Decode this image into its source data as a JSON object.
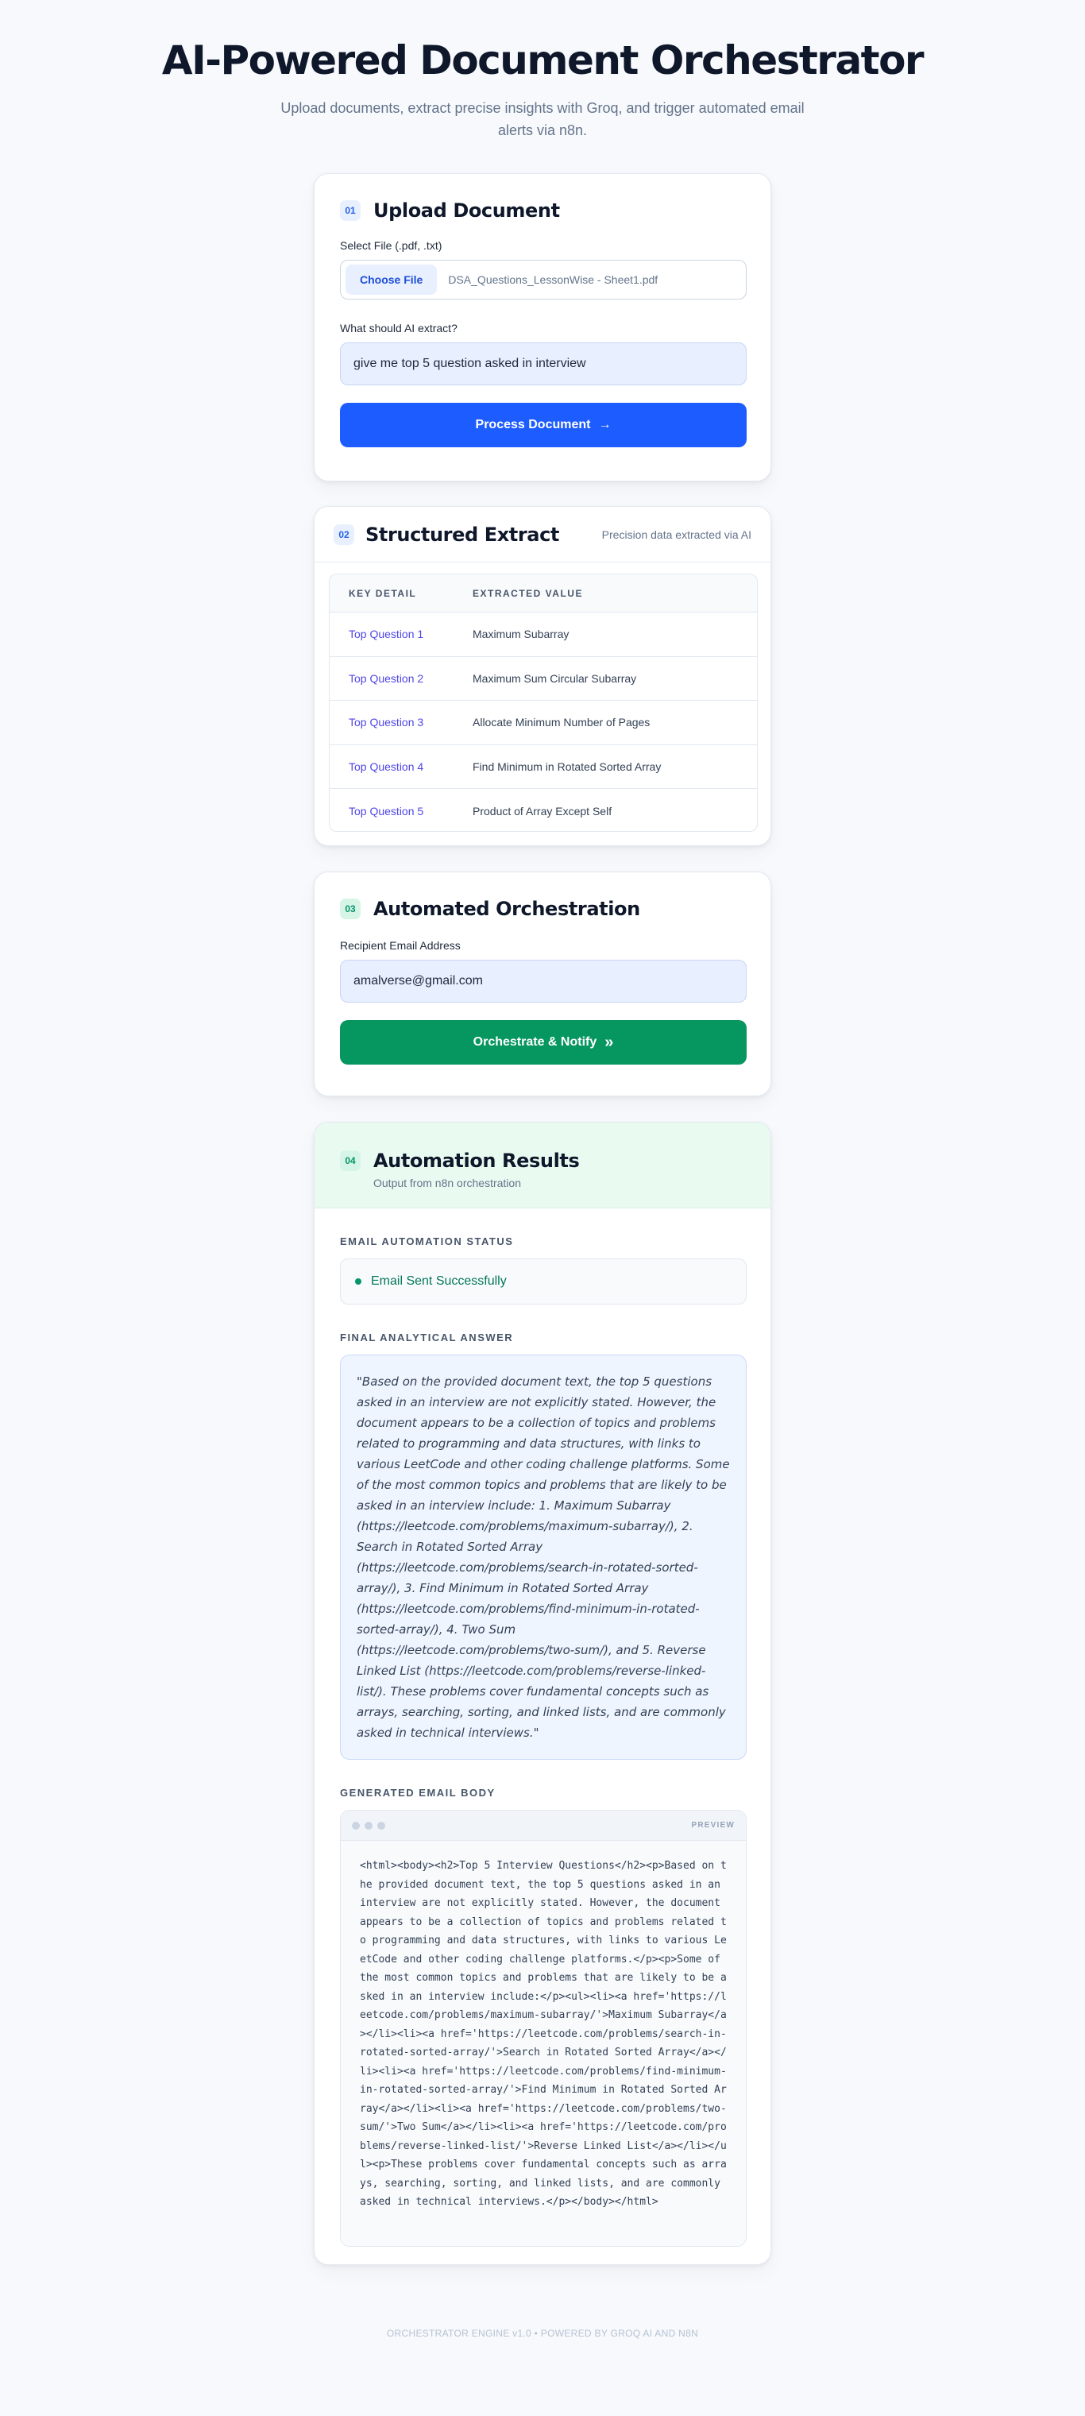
{
  "hero": {
    "title": "AI-Powered Document Orchestrator",
    "subtitle": "Upload documents, extract precise insights with Groq, and trigger automated email alerts via n8n."
  },
  "upload": {
    "step": "01",
    "title": "Upload Document",
    "file_label": "Select File (.pdf, .txt)",
    "choose_file": "Choose File",
    "file_name": "DSA_Questions_LessonWise - Sheet1.pdf",
    "prompt_label": "What should AI extract?",
    "prompt_value": "give me top 5 question asked in interview",
    "process_button": "Process Document",
    "process_icon": "→"
  },
  "extract": {
    "step": "02",
    "title": "Structured Extract",
    "subtitle": "Precision data extracted via AI",
    "col_key": "KEY DETAIL",
    "col_value": "EXTRACTED VALUE",
    "rows": [
      {
        "key": "Top Question 1",
        "value": "Maximum Subarray"
      },
      {
        "key": "Top Question 2",
        "value": "Maximum Sum Circular Subarray"
      },
      {
        "key": "Top Question 3",
        "value": "Allocate Minimum Number of Pages"
      },
      {
        "key": "Top Question 4",
        "value": "Find Minimum in Rotated Sorted Array"
      },
      {
        "key": "Top Question 5",
        "value": "Product of Array Except Self"
      }
    ]
  },
  "orchestration": {
    "step": "03",
    "title": "Automated Orchestration",
    "email_label": "Recipient Email Address",
    "email_value": "amalverse@gmail.com",
    "button": "Orchestrate & Notify",
    "button_icon": "»"
  },
  "results": {
    "step": "04",
    "title": "Automation Results",
    "subtitle": "Output from n8n orchestration",
    "status_label": "EMAIL AUTOMATION STATUS",
    "status_text": "Email Sent Successfully",
    "answer_label": "FINAL ANALYTICAL ANSWER",
    "answer_text": "\"Based on the provided document text, the top 5 questions asked in an interview are not explicitly stated. However, the document appears to be a collection of topics and problems related to programming and data structures, with links to various LeetCode and other coding challenge platforms. Some of the most common topics and problems that are likely to be asked in an interview include: 1. Maximum Subarray (https://leetcode.com/problems/maximum-subarray/), 2. Search in Rotated Sorted Array (https://leetcode.com/problems/search-in-rotated-sorted-array/), 3. Find Minimum in Rotated Sorted Array (https://leetcode.com/problems/find-minimum-in-rotated-sorted-array/), 4. Two Sum (https://leetcode.com/problems/two-sum/), and 5. Reverse Linked List (https://leetcode.com/problems/reverse-linked-list/). These problems cover fundamental concepts such as arrays, searching, sorting, and linked lists, and are commonly asked in technical interviews.\"",
    "email_label": "GENERATED EMAIL BODY",
    "preview_tag": "PREVIEW",
    "email_body": "<html><body><h2>Top 5 Interview Questions</h2><p>Based on the provided document text, the top 5 questions asked in an interview are not explicitly stated. However, the document appears to be a collection of topics and problems related to programming and data structures, with links to various LeetCode and other coding challenge platforms.</p><p>Some of the most common topics and problems that are likely to be asked in an interview include:</p><ul><li><a href='https://leetcode.com/problems/maximum-subarray/'>Maximum Subarray</a></li><li><a href='https://leetcode.com/problems/search-in-rotated-sorted-array/'>Search in Rotated Sorted Array</a></li><li><a href='https://leetcode.com/problems/find-minimum-in-rotated-sorted-array/'>Find Minimum in Rotated Sorted Array</a></li><li><a href='https://leetcode.com/problems/two-sum/'>Two Sum</a></li><li><a href='https://leetcode.com/problems/reverse-linked-list/'>Reverse Linked List</a></li></ul><p>These problems cover fundamental concepts such as arrays, searching, sorting, and linked lists, and are commonly asked in technical interviews.</p></body></html>"
  },
  "footer": {
    "text": "ORCHESTRATOR ENGINE v1.0 • POWERED BY GROQ AI AND N8N"
  },
  "colors": {
    "primary_blue": "#1d5cff",
    "success_green": "#069660",
    "accent_indigo": "#4f46e5"
  }
}
